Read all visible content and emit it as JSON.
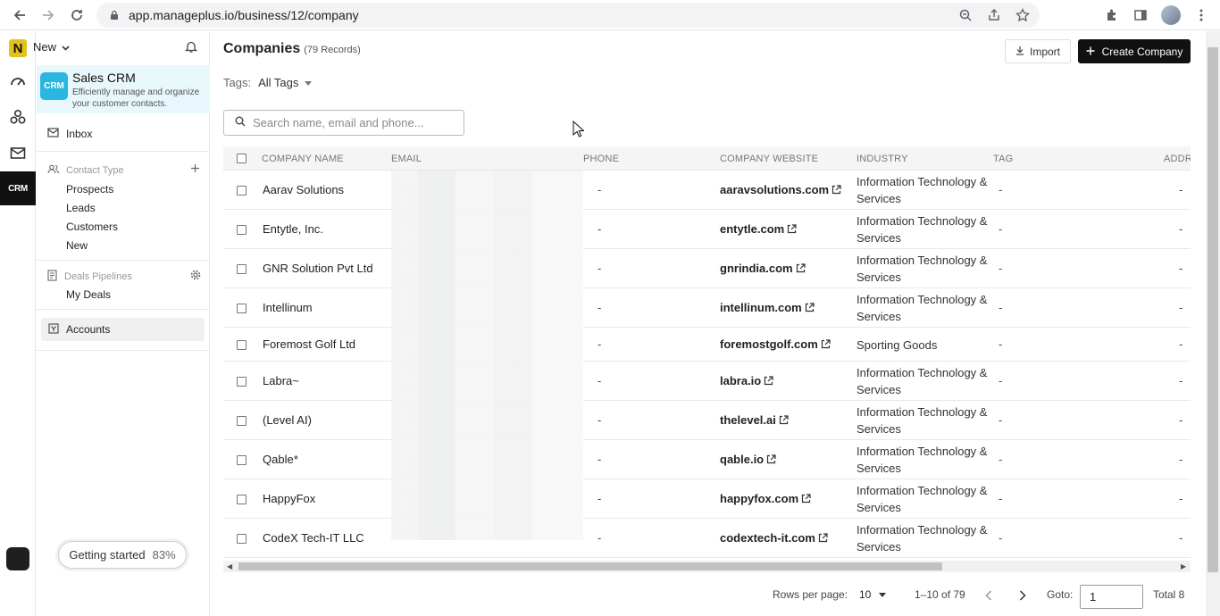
{
  "browser": {
    "url": "app.manageplus.io/business/12/company"
  },
  "sidebar": {
    "workspace": "New",
    "crm": {
      "logo": "CRM",
      "title": "Sales CRM",
      "description": "Efficiently manage and organize your customer contacts."
    },
    "inbox": "Inbox",
    "contact_type_heading": "Contact Type",
    "contact_types": [
      "Prospects",
      "Leads",
      "Customers",
      "New"
    ],
    "deals_heading": "Deals Pipelines",
    "deals": [
      "My Deals"
    ],
    "accounts": "Accounts",
    "getting_started": {
      "label": "Getting started",
      "percent": "83%"
    },
    "rail_active": "CRM"
  },
  "header": {
    "title": "Companies",
    "records": "(79 Records)",
    "import_label": "Import",
    "create_label": "Create Company",
    "tags_label": "Tags:",
    "tags_value": "All Tags"
  },
  "search": {
    "placeholder": "Search name, email and phone..."
  },
  "table": {
    "columns": [
      "COMPANY NAME",
      "EMAIL",
      "PHONE",
      "COMPANY WEBSITE",
      "INDUSTRY",
      "TAG",
      "ADDR"
    ],
    "rows": [
      {
        "name": "Aarav Solutions",
        "phone": "-",
        "website": "aaravsolutions.com",
        "industry": "Information Technology & Services",
        "tag": "-",
        "addr": "-"
      },
      {
        "name": "Entytle, Inc.",
        "phone": "-",
        "website": "entytle.com",
        "industry": "Information Technology & Services",
        "tag": "-",
        "addr": "-"
      },
      {
        "name": "GNR Solution Pvt Ltd",
        "phone": "-",
        "website": "gnrindia.com",
        "industry": "Information Technology & Services",
        "tag": "-",
        "addr": "-"
      },
      {
        "name": "Intellinum",
        "phone": "-",
        "website": "intellinum.com",
        "industry": "Information Technology & Services",
        "tag": "-",
        "addr": "-"
      },
      {
        "name": "Foremost Golf Ltd",
        "phone": "-",
        "website": "foremostgolf.com",
        "industry": "Sporting Goods",
        "tag": "-",
        "addr": "-"
      },
      {
        "name": "Labra~",
        "phone": "-",
        "website": "labra.io",
        "industry": "Information Technology & Services",
        "tag": "-",
        "addr": "-"
      },
      {
        "name": "(Level AI)",
        "phone": "-",
        "website": "thelevel.ai",
        "industry": "Information Technology & Services",
        "tag": "-",
        "addr": "-"
      },
      {
        "name": "Qable*",
        "phone": "-",
        "website": "qable.io",
        "industry": "Information Technology & Services",
        "tag": "-",
        "addr": "-"
      },
      {
        "name": "HappyFox",
        "phone": "-",
        "website": "happyfox.com",
        "industry": "Information Technology & Services",
        "tag": "-",
        "addr": "-"
      },
      {
        "name": "CodeX Tech-IT LLC",
        "phone": "-",
        "website": "codextech-it.com",
        "industry": "Information Technology & Services",
        "tag": "-",
        "addr": "-"
      }
    ]
  },
  "pagination": {
    "rows_per_page_label": "Rows per page:",
    "rows_per_page": "10",
    "range": "1–10 of 79",
    "goto_label": "Goto:",
    "goto_value": "1",
    "total": "Total 8"
  }
}
